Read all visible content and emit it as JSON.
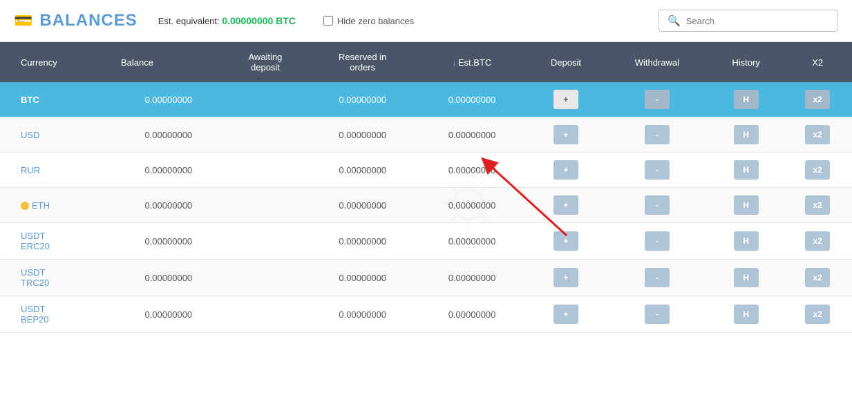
{
  "header": {
    "title": "BALANCES",
    "est_label": "Est. equivalent:",
    "est_value": "0.00000000 BTC",
    "hide_zero_label": "Hide zero balances",
    "search_placeholder": "Search"
  },
  "table": {
    "columns": [
      {
        "key": "currency",
        "label": "Currency"
      },
      {
        "key": "balance",
        "label": "Balance"
      },
      {
        "key": "awaiting",
        "label": "Awaiting deposit"
      },
      {
        "key": "reserved",
        "label": "Reserved in orders"
      },
      {
        "key": "estbtc",
        "label": "Est.BTC",
        "sortable": true
      },
      {
        "key": "deposit",
        "label": "Deposit"
      },
      {
        "key": "withdrawal",
        "label": "Withdrawal"
      },
      {
        "key": "history",
        "label": "History"
      },
      {
        "key": "x2",
        "label": "X2"
      }
    ],
    "rows": [
      {
        "currency": "BTC",
        "balance": "0.00000000",
        "awaiting": "",
        "reserved": "0.00000000",
        "estbtc": "0.00000000",
        "selected": true
      },
      {
        "currency": "USD",
        "balance": "0.00000000",
        "awaiting": "",
        "reserved": "0.00000000",
        "estbtc": "0.00000000",
        "selected": false
      },
      {
        "currency": "RUR",
        "balance": "0.00000000",
        "awaiting": "",
        "reserved": "0.00000000",
        "estbtc": "0.00000000",
        "selected": false
      },
      {
        "currency": "ETH",
        "balance": "0.00000000",
        "awaiting": "",
        "reserved": "0.00000000",
        "estbtc": "0.00000000",
        "selected": false,
        "eth_dot": true
      },
      {
        "currency": "USDT\nERC20",
        "balance": "0.00000000",
        "awaiting": "",
        "reserved": "0.00000000",
        "estbtc": "0.00000000",
        "selected": false
      },
      {
        "currency": "USDT\nTRC20",
        "balance": "0.00000000",
        "awaiting": "",
        "reserved": "0.00000000",
        "estbtc": "0.00000000",
        "selected": false
      },
      {
        "currency": "USDT\nBEP20",
        "balance": "0.00000000",
        "awaiting": "",
        "reserved": "0.00000000",
        "estbtc": "0.00000000",
        "selected": false
      }
    ],
    "btn_labels": {
      "deposit": "+",
      "withdrawal": "-",
      "history": "H",
      "x2": "x2"
    }
  }
}
